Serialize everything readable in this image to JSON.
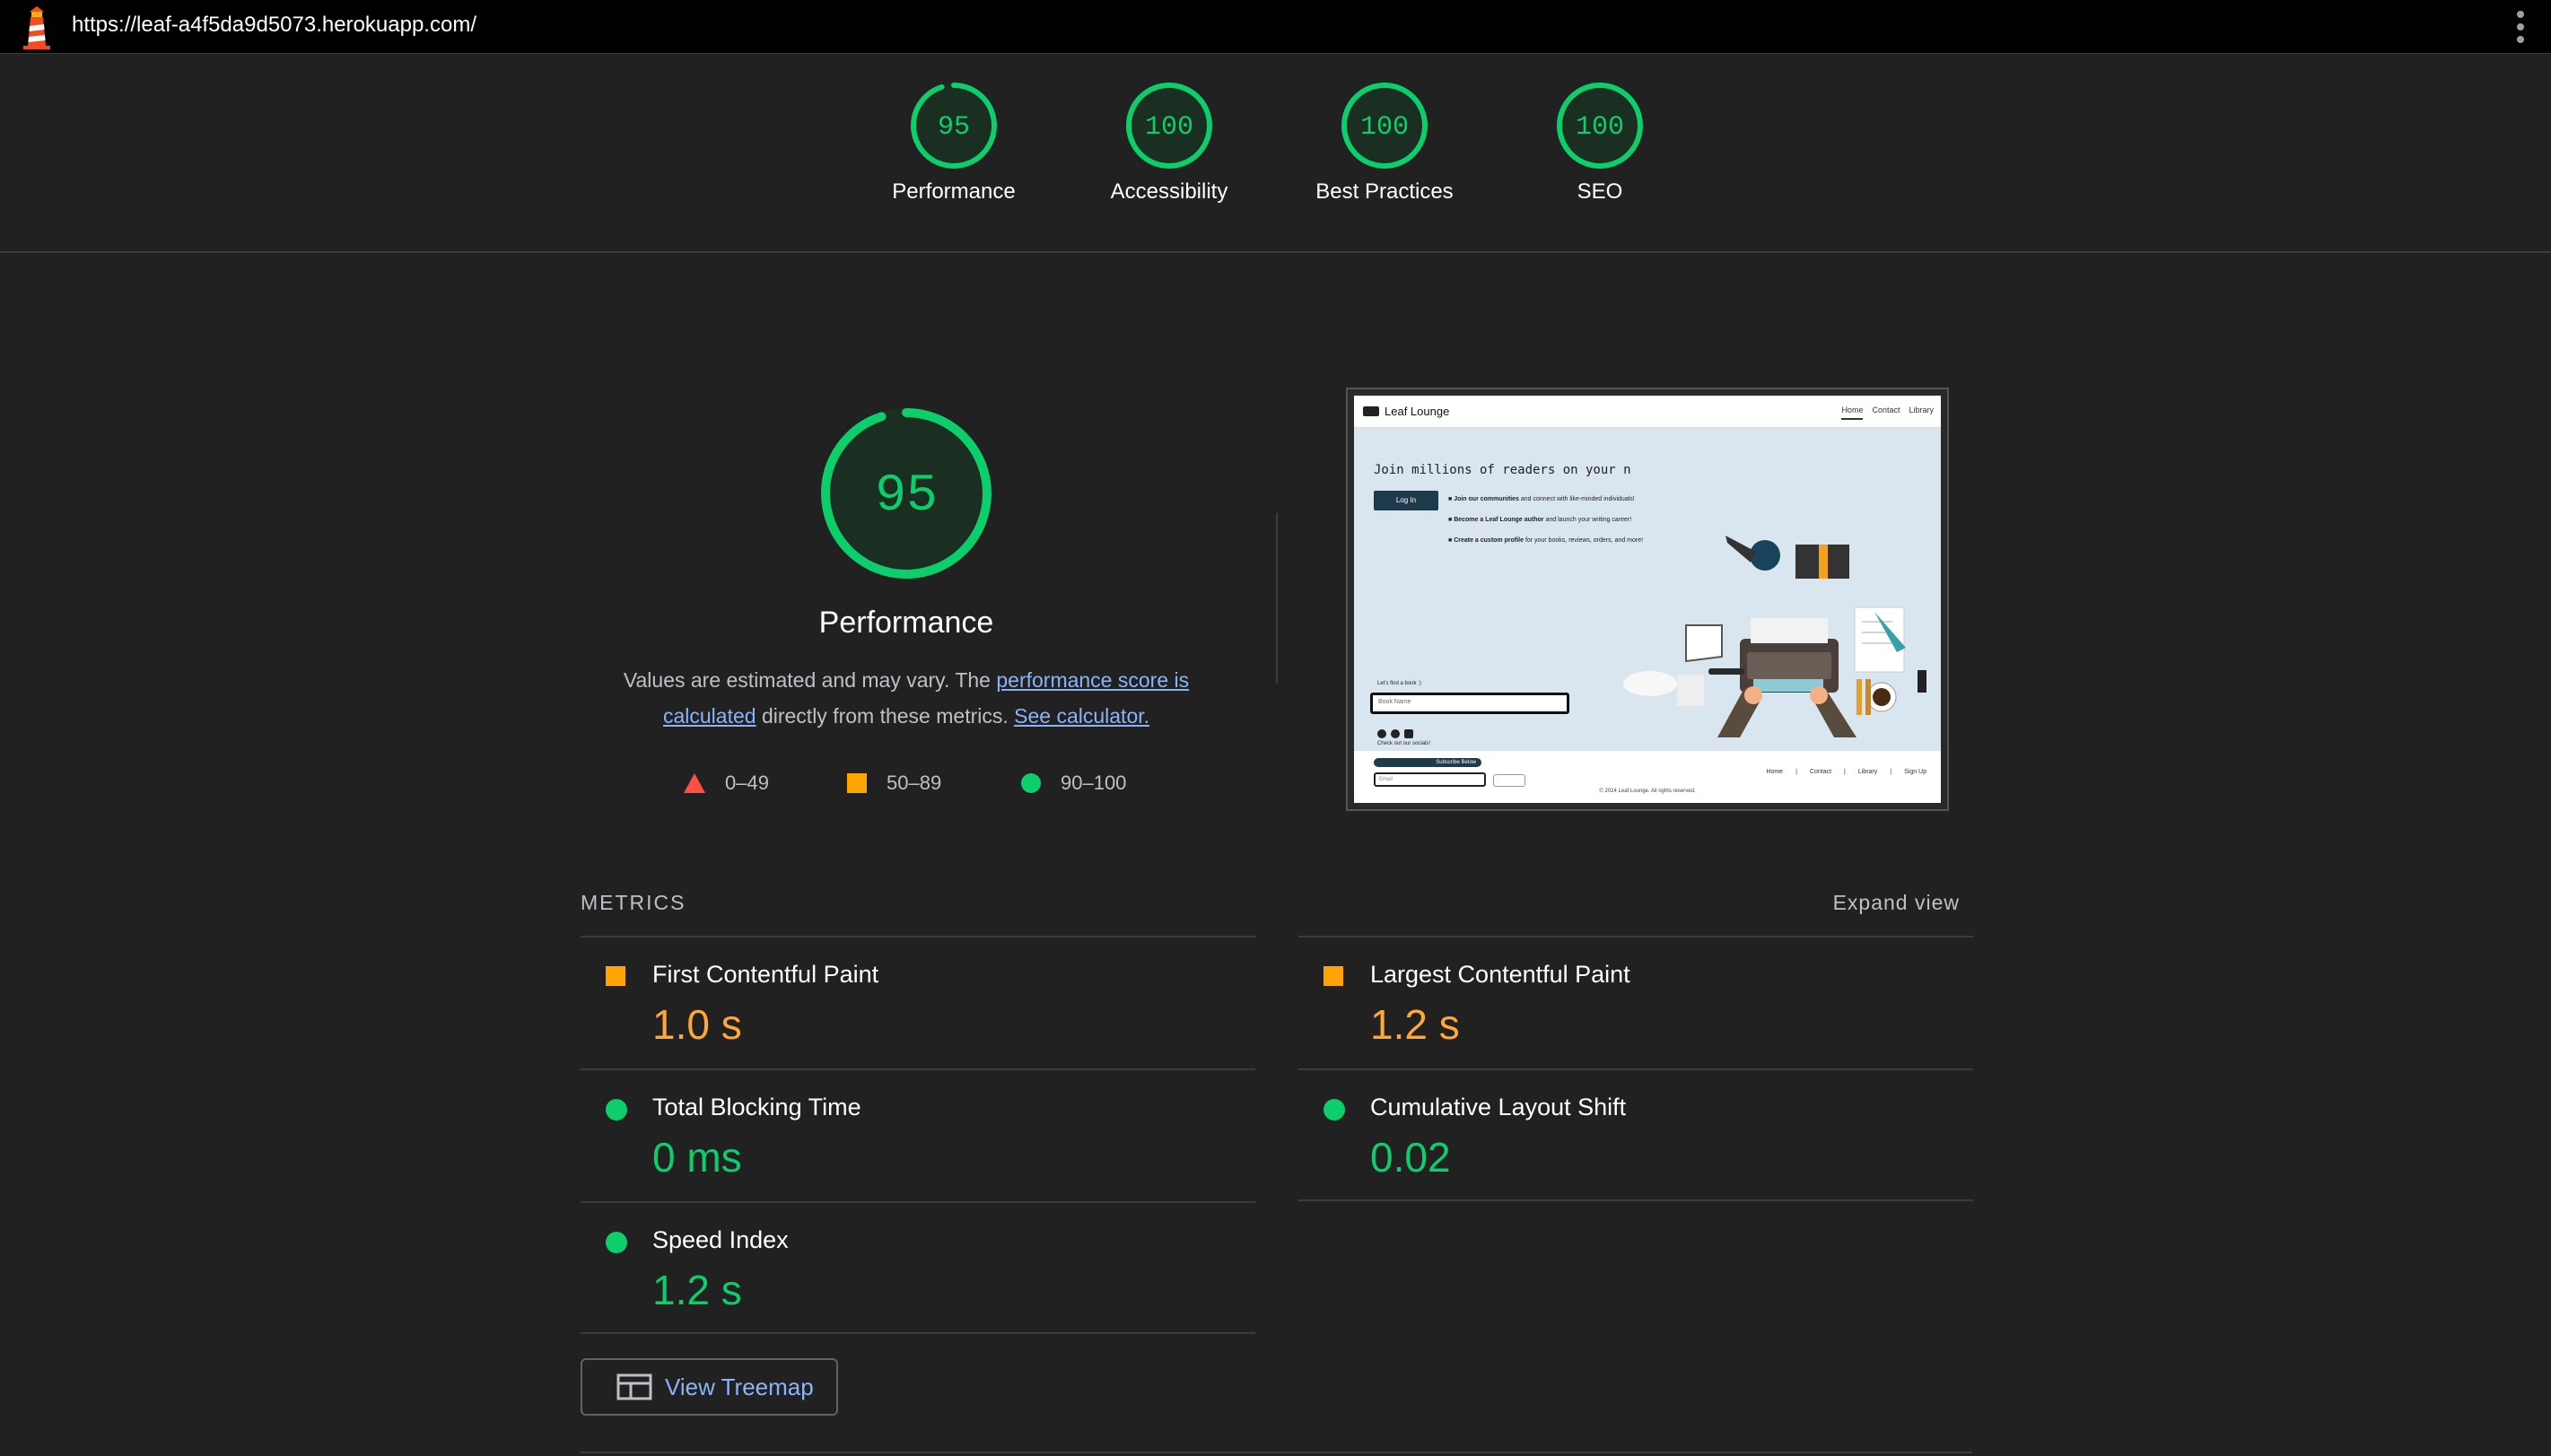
{
  "topbar": {
    "url": "https://leaf-a4f5da9d5073.herokuapp.com/",
    "menu_icon": "kebab-menu-icon"
  },
  "gauges": [
    {
      "value": "95",
      "label": "Performance"
    },
    {
      "value": "100",
      "label": "Accessibility"
    },
    {
      "value": "100",
      "label": "Best Practices"
    },
    {
      "value": "100",
      "label": "SEO"
    }
  ],
  "performance": {
    "score": "95",
    "score_fraction": 0.95,
    "title": "Performance",
    "desc_prefix": "Values are estimated and may vary. The ",
    "link1": "performance score is calculated",
    "desc_mid": " directly from these metrics. ",
    "link2": "See calculator."
  },
  "legend": [
    {
      "range": "0–49",
      "shape": "triangle",
      "color": "#ff4e42"
    },
    {
      "range": "50–89",
      "shape": "square",
      "color": "#ffa400"
    },
    {
      "range": "90–100",
      "shape": "circle",
      "color": "#0cce6b"
    }
  ],
  "screenshot": {
    "brand": "Leaf Lounge",
    "nav": [
      "Home",
      "Contact",
      "Library"
    ],
    "hero": "Join millions of readers on your n",
    "login": "Log In",
    "bullets": [
      {
        "bold": "Join our communities",
        "rest": " and connect with like-minded individuals!"
      },
      {
        "bold": "Become a Leaf Lounge author",
        "rest": " and launch your writing career!"
      },
      {
        "bold": "Create a custom profile",
        "rest": " for your books, reviews, orders, and more!"
      }
    ],
    "find_label": "Let's find a book :)",
    "search_placeholder": "Book Name",
    "social_caption": "Check out our socials!",
    "subscribe": "Subscribe Below",
    "email_placeholder": "Email",
    "footer_links": [
      "Home",
      "|",
      "Contact",
      "|",
      "Library",
      "|",
      "Sign Up"
    ],
    "copyright": "© 2024 Leaf Lounge. All rights reserved."
  },
  "metrics": {
    "header": "METRICS",
    "expand": "Expand view",
    "items": [
      {
        "name": "First Contentful Paint",
        "value": "1.0 s",
        "status": "average"
      },
      {
        "name": "Largest Contentful Paint",
        "value": "1.2 s",
        "status": "average"
      },
      {
        "name": "Total Blocking Time",
        "value": "0 ms",
        "status": "pass"
      },
      {
        "name": "Cumulative Layout Shift",
        "value": "0.02",
        "status": "pass"
      },
      {
        "name": "Speed Index",
        "value": "1.2 s",
        "status": "pass"
      }
    ]
  },
  "treemap": {
    "label": "View Treemap"
  },
  "colors": {
    "pass": "#0cce6b",
    "average": "#ffa834",
    "fail": "#ff4e42",
    "link": "#8ab4f8"
  }
}
